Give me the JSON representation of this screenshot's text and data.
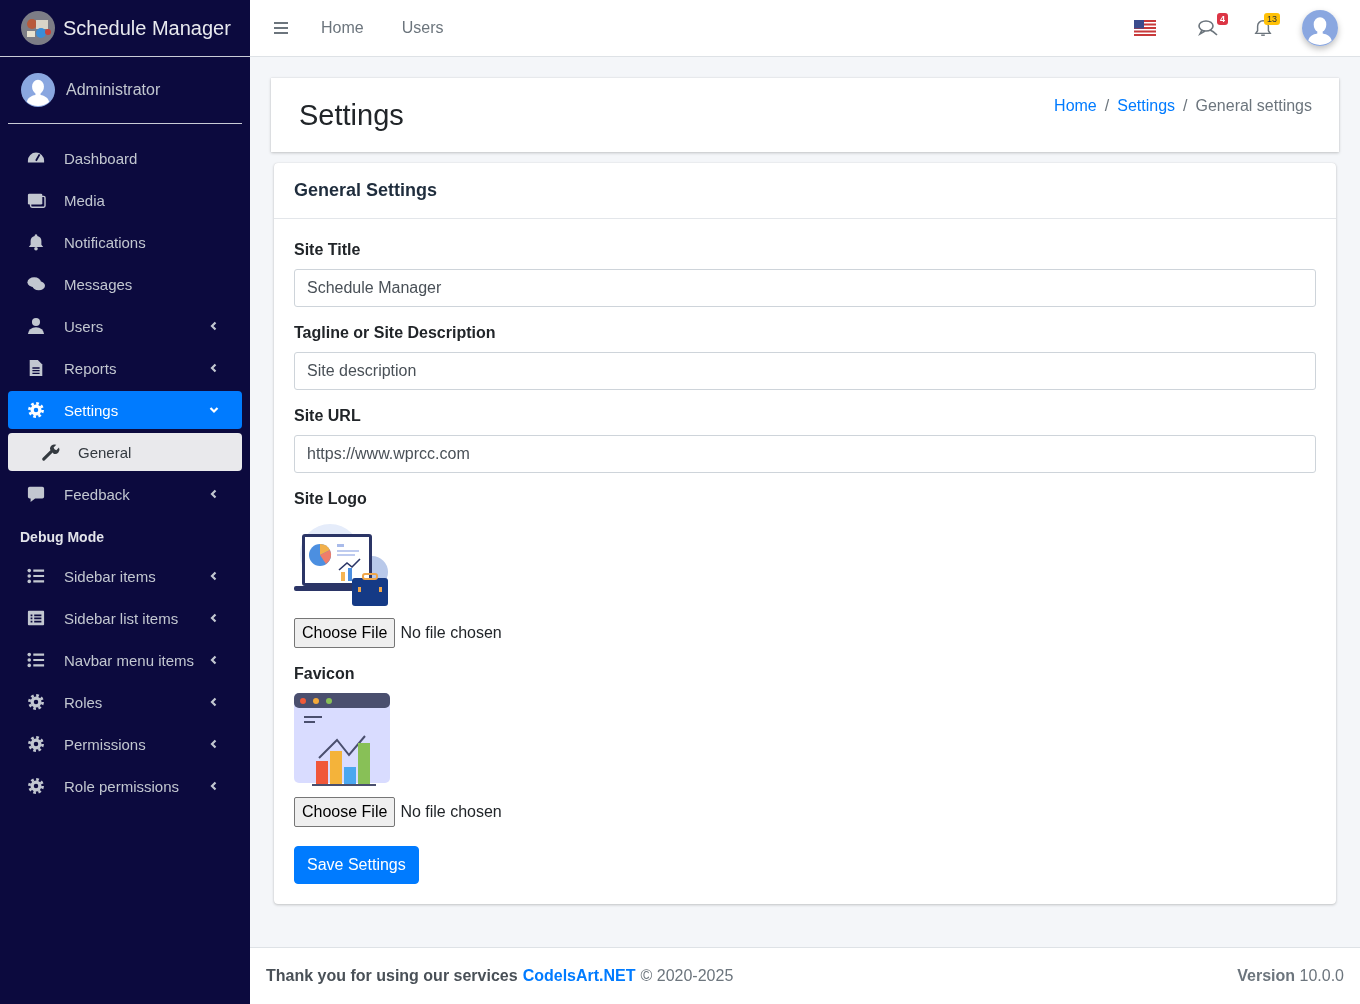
{
  "brand": {
    "title": "Schedule Manager"
  },
  "sidebar": {
    "user": "Administrator",
    "items": [
      {
        "kind": "link",
        "label": "Dashboard",
        "selected": false
      },
      {
        "kind": "link",
        "label": "Media",
        "selected": false
      },
      {
        "kind": "link",
        "label": "Notifications",
        "selected": false
      },
      {
        "kind": "link",
        "label": "Messages",
        "selected": false
      },
      {
        "kind": "link",
        "label": "Users",
        "selected": false,
        "expanded": false
      },
      {
        "kind": "link",
        "label": "Reports",
        "selected": false,
        "expanded": false
      },
      {
        "kind": "link",
        "label": "Settings",
        "selected": true,
        "expanded": true,
        "children": [
          {
            "label": "General",
            "selected": true
          }
        ]
      },
      {
        "kind": "link",
        "label": "Feedback",
        "selected": false,
        "expanded": false
      },
      {
        "kind": "header",
        "label": "Debug Mode"
      },
      {
        "kind": "link",
        "label": "Sidebar items",
        "selected": false,
        "expanded": false
      },
      {
        "kind": "link",
        "label": "Sidebar list items",
        "selected": false,
        "expanded": false
      },
      {
        "kind": "link",
        "label": "Navbar menu items",
        "selected": false,
        "expanded": false
      },
      {
        "kind": "link",
        "label": "Roles",
        "selected": false,
        "expanded": false
      },
      {
        "kind": "link",
        "label": "Permissions",
        "selected": false,
        "expanded": false
      },
      {
        "kind": "link",
        "label": "Role permissions",
        "selected": false,
        "expanded": false
      }
    ]
  },
  "navbar": {
    "links": [
      "Home",
      "Users"
    ],
    "messages_badge": "4",
    "notifications_badge": "13"
  },
  "page": {
    "title": "Settings",
    "breadcrumb": [
      {
        "label": "Home",
        "current": false
      },
      {
        "separator": "/",
        "label": "Settings",
        "current": false
      },
      {
        "separator": "/",
        "label": "General settings",
        "current": true
      }
    ]
  },
  "form": {
    "title": "General Settings",
    "fields": [
      {
        "kind": "text",
        "label": "Site Title",
        "value": "Schedule Manager"
      },
      {
        "kind": "text",
        "label": "Tagline or Site Description",
        "value": "Site description"
      },
      {
        "kind": "text",
        "label": "Site URL",
        "value": "https://www.wprcc.com"
      },
      {
        "kind": "file",
        "label": "Site Logo",
        "button": "Choose File",
        "status": "No file chosen"
      },
      {
        "kind": "file",
        "label": "Favicon",
        "button": "Choose File",
        "status": "No file chosen"
      }
    ],
    "submit": "Save Settings"
  },
  "footer": {
    "thanks": "Thank you for using our services",
    "link": "CodelsArt.NET",
    "copyright": "© 2020-2025",
    "version": "**Version** 10.0.0"
  }
}
